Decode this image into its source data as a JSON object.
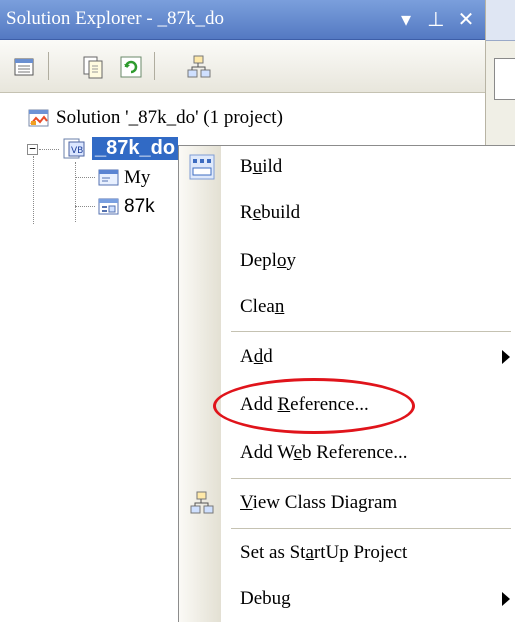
{
  "window": {
    "title": "Solution Explorer - _87k_do",
    "buttons": {
      "dropdown": "▾",
      "pin": "⊥",
      "close": "✕"
    }
  },
  "toolbar": {
    "icons": [
      "properties-icon",
      "show-all-files-icon",
      "refresh-icon",
      "class-diagram-icon"
    ]
  },
  "tree": {
    "solution_label": "Solution '_87k_do' (1 project)",
    "project_label": "_87k_do",
    "child1_label": "My",
    "child2_label": "87k"
  },
  "menu": {
    "items": [
      {
        "pre": "B",
        "acc": "u",
        "post": "ild",
        "icon": "build-icon"
      },
      {
        "pre": "R",
        "acc": "e",
        "post": "build"
      },
      {
        "pre": "Depl",
        "acc": "o",
        "post": "y"
      },
      {
        "pre": "Clea",
        "acc": "n",
        "post": ""
      },
      {
        "pre": "A",
        "acc": "d",
        "post": "d",
        "submenu": true
      },
      {
        "pre": "Add ",
        "acc": "R",
        "post": "eference..."
      },
      {
        "pre": "Add W",
        "acc": "e",
        "post": "b Reference..."
      },
      {
        "pre": "",
        "acc": "V",
        "post": "iew Class Diagram",
        "icon": "class-diagram-icon"
      },
      {
        "pre": "Set as St",
        "acc": "a",
        "post": "rtUp Project"
      },
      {
        "pre": "Debug",
        "acc": "",
        "post": "",
        "submenu": true
      }
    ]
  },
  "colors": {
    "titlebar": "#5479c2",
    "selection": "#316ac5",
    "highlight": "#e0141b"
  }
}
